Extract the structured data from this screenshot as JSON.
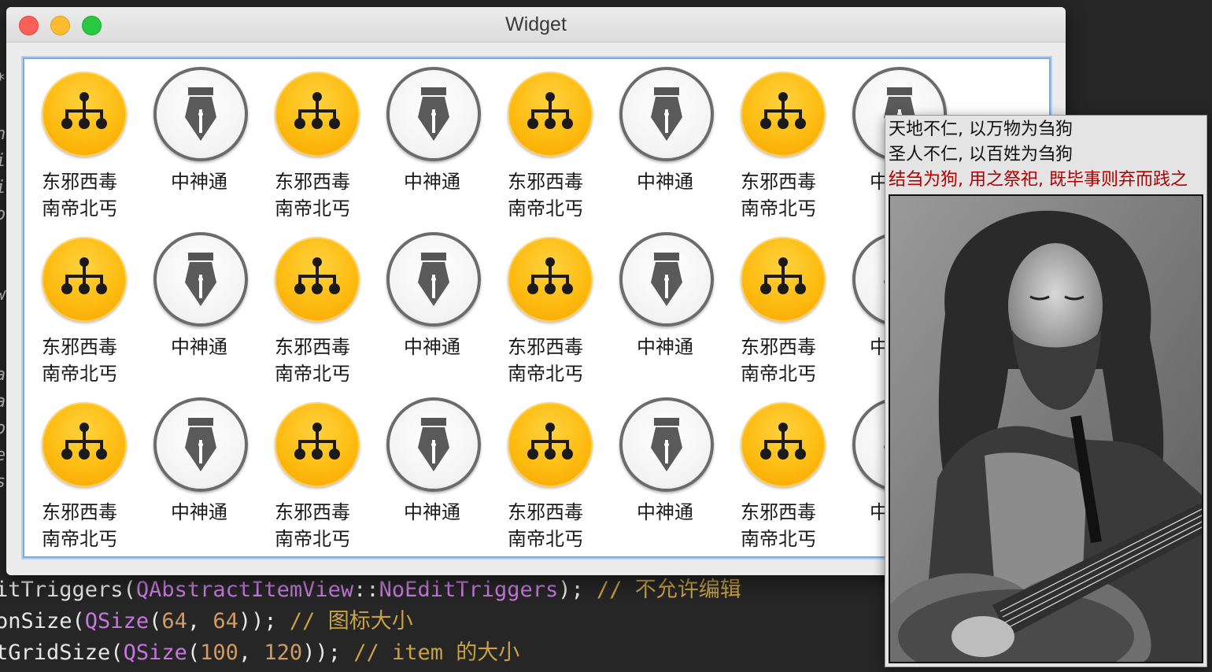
{
  "window": {
    "title": "Widget",
    "buttons": [
      "close",
      "minimize",
      "zoom"
    ]
  },
  "list": {
    "items": [
      {
        "icon": "org-chart-icon",
        "label_line1": "东邪西毒",
        "label_line2": "南帝北丐"
      },
      {
        "icon": "fountain-pen-icon",
        "label_line1": "中神通",
        "label_line2": ""
      },
      {
        "icon": "org-chart-icon",
        "label_line1": "东邪西毒",
        "label_line2": "南帝北丐"
      },
      {
        "icon": "fountain-pen-icon",
        "label_line1": "中神通",
        "label_line2": ""
      },
      {
        "icon": "org-chart-icon",
        "label_line1": "东邪西毒",
        "label_line2": "南帝北丐"
      },
      {
        "icon": "fountain-pen-icon",
        "label_line1": "中神通",
        "label_line2": ""
      },
      {
        "icon": "org-chart-icon",
        "label_line1": "东邪西毒",
        "label_line2": "南帝北丐"
      },
      {
        "icon": "fountain-pen-icon",
        "label_line1": "中神通",
        "label_line2": ""
      }
    ],
    "rows_visible": 3,
    "colors": {
      "yellow": "#fdbb10",
      "pen_ring": "#6b6b6b",
      "selection_border": "#7ea9e3"
    }
  },
  "tooltip": {
    "line1": "天地不仁, 以万物为刍狗",
    "line2": "圣人不仁, 以百姓为刍狗",
    "line3": "结刍为狗, 用之祭祀, 既毕事则弃而践之",
    "line3_color": "#b00000",
    "image": "black-and-white photo of long-haired man playing guitar"
  },
  "code": {
    "line1": {
      "a": "itTriggers(",
      "b": "QAbstractItemView",
      "c": "::",
      "d": "NoEditTriggers",
      "e": "); ",
      "f": "// 不允许编辑"
    },
    "line2": {
      "a": "onSize(",
      "b": "QSize",
      "c": "(",
      "d": "64",
      "e": ", ",
      "f": "64",
      "g": ")); ",
      "h": "// 图标大小"
    },
    "line3": {
      "a": "tGridSize(",
      "b": "QSize",
      "c": "(",
      "d": "100",
      "e": ", ",
      "f": "120",
      "g": ")); ",
      "h": "// item 的大小"
    },
    "left_glyphs": [
      "*",
      "",
      "h",
      "i",
      "i",
      "o",
      "",
      "",
      "w",
      "",
      "",
      "a",
      "a",
      "o",
      "e",
      "s"
    ]
  }
}
